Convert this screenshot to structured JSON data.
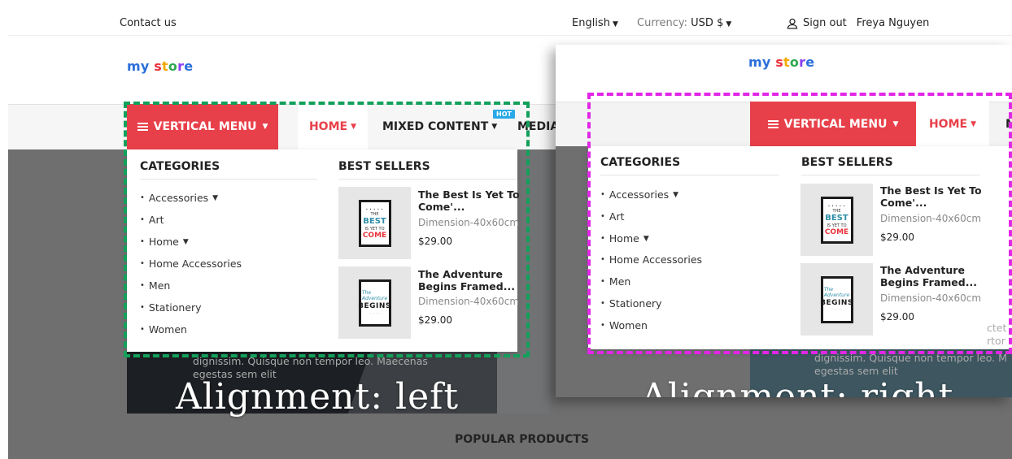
{
  "topbar": {
    "contact": "Contact us",
    "language": "English",
    "currency_label": "Currency:",
    "currency_value": "USD $",
    "signout": "Sign out",
    "username": "Freya Nguyen"
  },
  "logo": {
    "my": "my",
    "s": "s",
    "t": "t",
    "o": "o",
    "r": "r",
    "e": "e"
  },
  "nav": {
    "vertical_menu": "VERTICAL MENU",
    "home": "HOME",
    "mixed_content": "MIXED CONTENT",
    "hot_badge": "HOT",
    "media": "MEDIA",
    "right_cut": "M"
  },
  "dropdown": {
    "categories_title": "CATEGORIES",
    "best_sellers_title": "BEST SELLERS",
    "categories": [
      "Accessories",
      "Art",
      "Home",
      "Home Accessories",
      "Men",
      "Stationery",
      "Women"
    ],
    "products": [
      {
        "name_line1": "The Best Is Yet To",
        "name_line2": "Come'...",
        "dimension": "Dimension-40x60cm",
        "price": "$29.00",
        "poster": {
          "l1": "• • • • •",
          "l2a": "THE",
          "l2": "BEST",
          "l3": "IS YET TO",
          "l4": "COME"
        }
      },
      {
        "name_line1": "The Adventure",
        "name_line2": "Begins Framed...",
        "dimension": "Dimension-40x60cm",
        "price": "$29.00",
        "poster": {
          "l1": "The Adventure",
          "l2": "BEGINS",
          "l3": "- - - - -"
        }
      }
    ]
  },
  "hero_text": {
    "left_line1": "dignissim. Quisque non tempor leo. Maecenas",
    "left_line2": "egestas sem elit",
    "right_line1": "dignissim. Quisque non tempor leo. M",
    "right_line2": "egestas sem elit",
    "right_frag1": "ctet",
    "right_frag2": "rtor"
  },
  "captions": {
    "left": "Alignment: left",
    "right": "Alignment: right"
  },
  "section_title": "POPULAR PRODUCTS",
  "colors": {
    "accent": "#e8404a",
    "green_dash": "#12a05a",
    "magenta_dash": "#e126e6",
    "hot": "#29a9e8"
  }
}
